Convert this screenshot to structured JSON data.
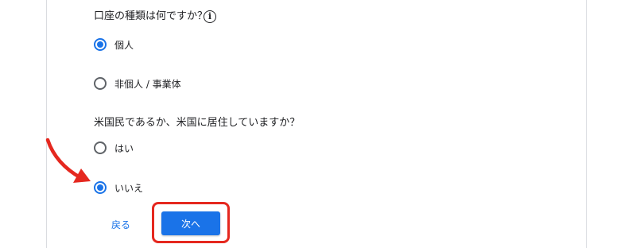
{
  "account_type": {
    "question": "口座の種類は何ですか？",
    "info_icon": "info-circle-icon",
    "info_glyph": "i",
    "options": [
      {
        "label": "個人",
        "selected": true
      },
      {
        "label": "非個人 / 事業体",
        "selected": false
      }
    ]
  },
  "us_resident": {
    "question": "米国民であるか、米国に居住していますか？",
    "options": [
      {
        "label": "はい",
        "selected": false
      },
      {
        "label": "いいえ",
        "selected": true
      }
    ]
  },
  "actions": {
    "back_label": "戻る",
    "next_label": "次へ"
  },
  "annotations": {
    "arrow_icon": "red-arrow-icon",
    "highlight_color": "#e5281f"
  },
  "colors": {
    "accent": "#1a73e8",
    "annotation_red": "#e5281f",
    "text": "#202124"
  }
}
